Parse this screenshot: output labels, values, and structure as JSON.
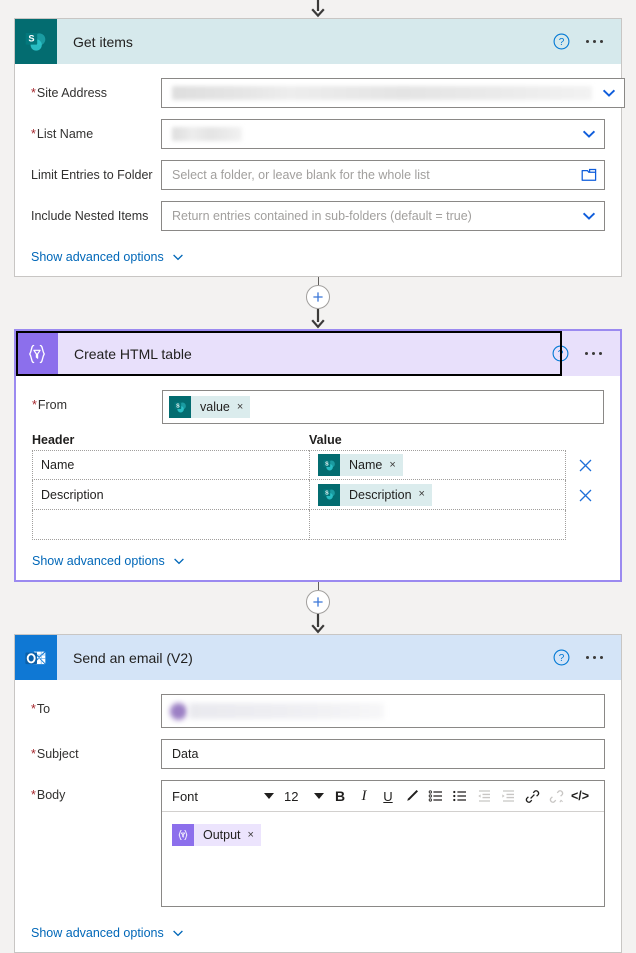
{
  "flow": {
    "connector_plus_label": "+",
    "steps": [
      {
        "id": "get-items",
        "title": "Get items",
        "connector_type": "sharepoint",
        "icon_name": "sharepoint-icon",
        "help_icon": "help-circle-icon",
        "more_icon": "ellipsis-icon",
        "selected": false,
        "fields": [
          {
            "label": "Site Address",
            "required": true,
            "type": "dropdown-redacted",
            "value": "",
            "placeholder": ""
          },
          {
            "label": "List Name",
            "required": true,
            "type": "dropdown-redacted",
            "value": "",
            "placeholder": ""
          },
          {
            "label": "Limit Entries to Folder",
            "required": false,
            "type": "folder-picker",
            "value": "",
            "placeholder": "Select a folder, or leave blank for the whole list"
          },
          {
            "label": "Include Nested Items",
            "required": false,
            "type": "dropdown",
            "value": "",
            "placeholder": "Return entries contained in sub-folders (default = true)"
          }
        ],
        "advanced_label": "Show advanced options"
      },
      {
        "id": "create-html-table",
        "title": "Create HTML table",
        "connector_type": "dataoperation",
        "icon_name": "data-operation-icon",
        "help_icon": "help-circle-icon",
        "more_icon": "ellipsis-icon",
        "selected": true,
        "from": {
          "label": "From",
          "required": true,
          "token": {
            "text": "value",
            "source": "sharepoint",
            "remove_label": "×"
          }
        },
        "table": {
          "columns": [
            "Header",
            "Value"
          ],
          "rows": [
            {
              "header": "Name",
              "token": {
                "text": "Name",
                "source": "sharepoint",
                "remove_label": "×"
              },
              "delete_label": "✕"
            },
            {
              "header": "Description",
              "token": {
                "text": "Description",
                "source": "sharepoint",
                "remove_label": "×"
              },
              "delete_label": "✕"
            },
            {
              "header": "",
              "token": null,
              "delete_label": ""
            }
          ]
        },
        "advanced_label": "Show advanced options"
      },
      {
        "id": "send-an-email",
        "title": "Send an email (V2)",
        "connector_type": "outlook",
        "icon_name": "outlook-icon",
        "help_icon": "help-circle-icon",
        "more_icon": "ellipsis-icon",
        "selected": false,
        "to": {
          "label": "To",
          "required": true,
          "value_redacted": true
        },
        "subject": {
          "label": "Subject",
          "required": true,
          "value": "Data"
        },
        "body": {
          "label": "Body",
          "required": true,
          "toolbar": {
            "font_name": "Font",
            "font_size": "12",
            "buttons": [
              {
                "name": "bold-icon",
                "glyph": "B",
                "disabled": false
              },
              {
                "name": "italic-icon",
                "glyph": "I",
                "disabled": false
              },
              {
                "name": "underline-icon",
                "glyph": "U",
                "disabled": false
              },
              {
                "name": "text-color-pen-icon",
                "glyph": "pen",
                "disabled": false
              },
              {
                "name": "bulleted-list-icon",
                "glyph": "bullet",
                "disabled": false
              },
              {
                "name": "numbered-list-icon",
                "glyph": "number",
                "disabled": false
              },
              {
                "name": "decrease-indent-icon",
                "glyph": "outdent",
                "disabled": true
              },
              {
                "name": "increase-indent-icon",
                "glyph": "indent",
                "disabled": true
              },
              {
                "name": "insert-link-icon",
                "glyph": "link",
                "disabled": false
              },
              {
                "name": "remove-link-icon",
                "glyph": "unlink",
                "disabled": true
              },
              {
                "name": "code-view-icon",
                "glyph": "</>",
                "disabled": false
              }
            ]
          },
          "token": {
            "text": "Output",
            "source": "dataoperation",
            "remove_label": "×"
          }
        },
        "advanced_label": "Show advanced options"
      }
    ]
  },
  "colors": {
    "sharepoint_teal": "#036c70",
    "dataoperation_purple": "#8c6fec",
    "outlook_blue": "#0f78d4",
    "selected_border": "#9b8af0",
    "link_blue": "#0067b8",
    "required_red": "#a4262c",
    "header_sharepoint_bg": "#d6e9ec",
    "header_dataop_bg": "#e8e0fb",
    "header_outlook_bg": "#d4e4f7",
    "page_bg": "#f3f2f1"
  }
}
